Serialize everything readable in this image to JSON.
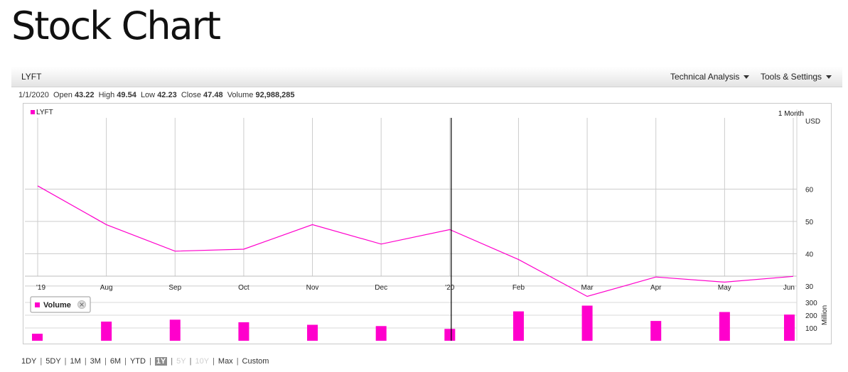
{
  "page": {
    "title": "Stock Chart"
  },
  "toolbar": {
    "symbol": "LYFT",
    "menus": [
      "Technical Analysis",
      "Tools & Settings"
    ]
  },
  "ohlc": {
    "date": "1/1/2020",
    "open_label": "Open",
    "open": "43.22",
    "high_label": "High",
    "high": "49.54",
    "low_label": "Low",
    "low": "42.23",
    "close_label": "Close",
    "close": "47.48",
    "volume_label": "Volume",
    "volume": "92,988,285"
  },
  "chart_data": {
    "type": "line",
    "series_name": "LYFT",
    "interval": "1 Month",
    "currency": "USD",
    "x_labels": [
      "'19",
      "Aug",
      "Sep",
      "Oct",
      "Nov",
      "Dec",
      "'20",
      "Feb",
      "Mar",
      "Apr",
      "May",
      "Jun"
    ],
    "price": [
      61,
      49,
      40.8,
      41.4,
      49,
      43,
      47.48,
      38.2,
      26.8,
      32.8,
      31.2,
      33
    ],
    "y_ticks": [
      30,
      40,
      50,
      60
    ],
    "y_range": [
      22,
      72
    ],
    "crosshair_label": "'20",
    "volume": {
      "legend": "Volume",
      "unit": "Million",
      "values": [
        55,
        150,
        165,
        145,
        125,
        115,
        93,
        230,
        275,
        155,
        225,
        205
      ],
      "y_ticks": [
        100,
        200,
        300
      ],
      "y_range": [
        0,
        300
      ]
    },
    "colors": {
      "line": "#ff00cc",
      "bars": "#ff00cc",
      "grid": "#cccccc"
    }
  },
  "time_ranges": {
    "items": [
      "1DY",
      "5DY",
      "1M",
      "3M",
      "6M",
      "YTD",
      "1Y",
      "5Y",
      "10Y",
      "Max",
      "Custom"
    ],
    "active": "1Y",
    "disabled": [
      "5Y",
      "10Y"
    ]
  }
}
